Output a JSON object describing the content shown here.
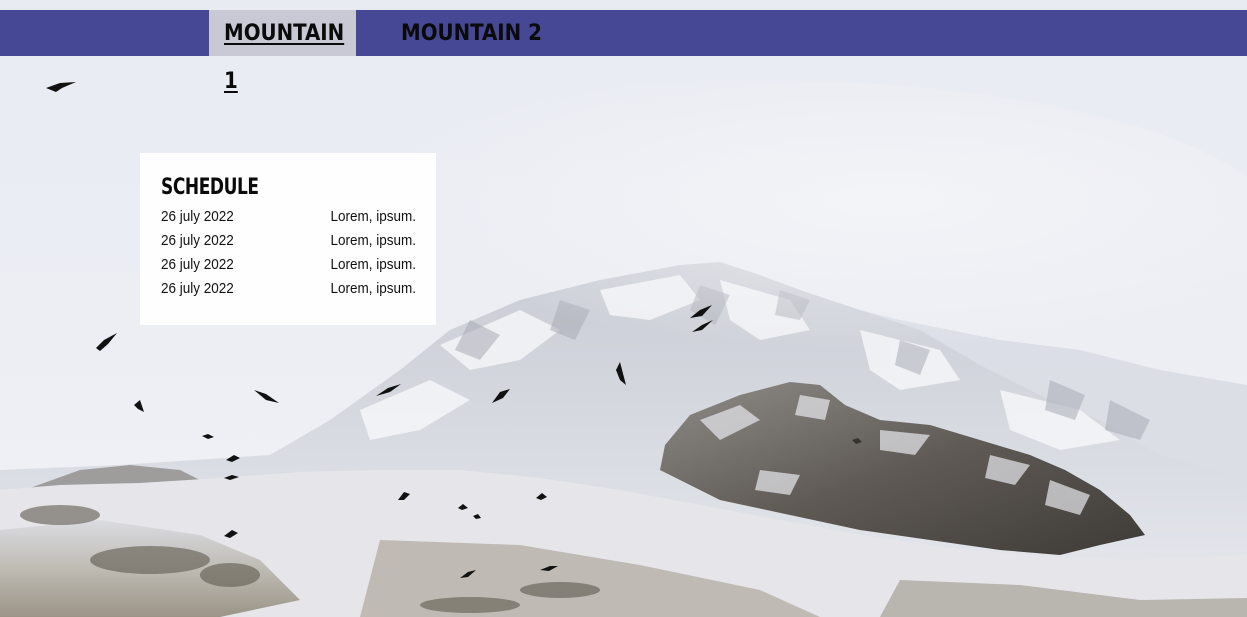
{
  "nav": {
    "tabs": [
      {
        "label": "MOUNTAIN 1",
        "active": true
      },
      {
        "label": "MOUNTAIN 2",
        "active": false
      }
    ],
    "bar_color": "#464896",
    "active_tab_color": "#c9c9d6"
  },
  "hero": {
    "image": "snowy-mountain-with-birds"
  },
  "schedule": {
    "title": "SCHEDULE",
    "rows": [
      {
        "date": "26 july 2022",
        "description": "Lorem, ipsum."
      },
      {
        "date": "26 july 2022",
        "description": "Lorem, ipsum."
      },
      {
        "date": "26 july 2022",
        "description": "Lorem, ipsum."
      },
      {
        "date": "26 july 2022",
        "description": "Lorem, ipsum."
      }
    ]
  }
}
